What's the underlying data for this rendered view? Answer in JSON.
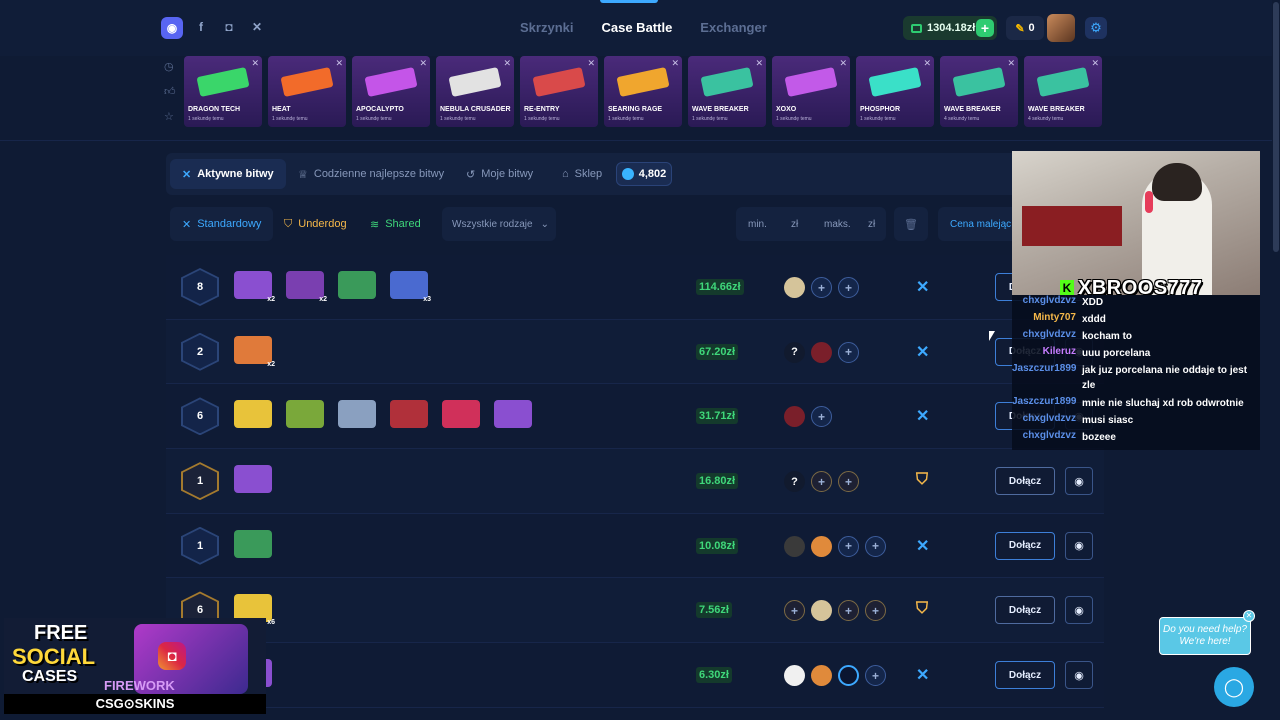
{
  "header": {
    "nav": [
      "Skrzynki",
      "Case Battle",
      "Exchanger"
    ],
    "nav_active": "Case Battle",
    "balance": "1304.18zł",
    "coins": "0",
    "social_icons": [
      "discord-icon",
      "facebook-icon",
      "instagram-icon",
      "x-icon"
    ]
  },
  "drops": [
    {
      "name": "DRAGON TECH",
      "time": "1 sekundę temu",
      "color": "#4a2a7a",
      "gun": "#3ad66a"
    },
    {
      "name": "HEAT",
      "time": "1 sekundę temu",
      "color": "#4a2a7a",
      "gun": "#f26b2a"
    },
    {
      "name": "APOCALYPTO",
      "time": "1 sekundę temu",
      "color": "#4a2a7a",
      "gun": "#c455e8"
    },
    {
      "name": "NEBULA CRUSADER",
      "time": "1 sekundę temu",
      "color": "#4a2a7a",
      "gun": "#e2e2e2"
    },
    {
      "name": "RE-ENTRY",
      "time": "1 sekundę temu",
      "color": "#4a2a7a",
      "gun": "#d94a4a"
    },
    {
      "name": "SEARING RAGE",
      "time": "1 sekundę temu",
      "color": "#4a2a7a",
      "gun": "#f0a62e"
    },
    {
      "name": "WAVE BREAKER",
      "time": "1 sekundę temu",
      "color": "#4a2a7a",
      "gun": "#3ac2a0"
    },
    {
      "name": "XOXO",
      "time": "1 sekundę temu",
      "color": "#4a2a7a",
      "gun": "#c25ae8"
    },
    {
      "name": "PHOSPHOR",
      "time": "1 sekundę temu",
      "color": "#4a2a7a",
      "gun": "#3ae0c8"
    },
    {
      "name": "WAVE BREAKER",
      "time": "4 sekundy temu",
      "color": "#4a2a7a",
      "gun": "#3ac2a0"
    },
    {
      "name": "WAVE BREAKER",
      "time": "4 sekundy temu",
      "color": "#4a2a7a",
      "gun": "#3ac2a0"
    }
  ],
  "tabs": {
    "active": "Aktywne bitwy",
    "daily": "Codzienne najlepsze bitwy",
    "mine": "Moje bitwy",
    "shop": "Sklep",
    "gems": "4,802"
  },
  "filters": {
    "standard": "Standardowy",
    "underdog": "Underdog",
    "shared": "Shared",
    "type_select": "Wszystkie rodzaje",
    "min_placeholder": "min.",
    "max_placeholder": "maks.",
    "currency": "zł",
    "sort": "Cena malejąc"
  },
  "battles": [
    {
      "rounds": "8",
      "gold": false,
      "price": "114.66zł",
      "mode": "standard",
      "join": "Dołącz"
    },
    {
      "rounds": "2",
      "gold": false,
      "price": "67.20zł",
      "mode": "standard",
      "join": "Dołącz"
    },
    {
      "rounds": "6",
      "gold": false,
      "price": "31.71zł",
      "mode": "standard",
      "join": "Dołącz"
    },
    {
      "rounds": "1",
      "gold": true,
      "price": "16.80zł",
      "mode": "underdog",
      "join": "Dołącz"
    },
    {
      "rounds": "1",
      "gold": false,
      "price": "10.08zł",
      "mode": "standard",
      "join": "Dołącz"
    },
    {
      "rounds": "6",
      "gold": true,
      "price": "7.56zł",
      "mode": "underdog",
      "join": "Dołącz"
    },
    {
      "rounds": "",
      "gold": false,
      "price": "6.30zł",
      "mode": "standard",
      "join": "Dołącz"
    }
  ],
  "stream": {
    "streamer": "XBROOS777",
    "chat": [
      {
        "user": "chxglvdzvz",
        "color": "#5b8fe8",
        "msg": "XDD"
      },
      {
        "user": "Minty707",
        "color": "#f5b84a",
        "msg": "xddd"
      },
      {
        "user": "chxglvdzvz",
        "color": "#5b8fe8",
        "msg": "kocham to"
      },
      {
        "user": "Kileruz",
        "color": "#c77dff",
        "msg": "uuu porcelana"
      },
      {
        "user": "Jaszczur1899",
        "color": "#5b8fe8",
        "msg": "jak juz porcelana nie oddaje to jest zle"
      },
      {
        "user": "Jaszczur1899",
        "color": "#5b8fe8",
        "msg": "mnie nie sluchaj xd rob odwrotnie"
      },
      {
        "user": "chxglvdzvz",
        "color": "#5b8fe8",
        "msg": "musi siasc"
      },
      {
        "user": "chxglvdzvz",
        "color": "#5b8fe8",
        "msg": "bozeee"
      }
    ]
  },
  "promo": {
    "line1": "FREE",
    "line2": "SOCIAL",
    "line3": "CASES",
    "firework": "FIREWORK",
    "brand": "CSG⊙SKINS"
  },
  "help": {
    "text": "Do you need help? We're here!"
  }
}
